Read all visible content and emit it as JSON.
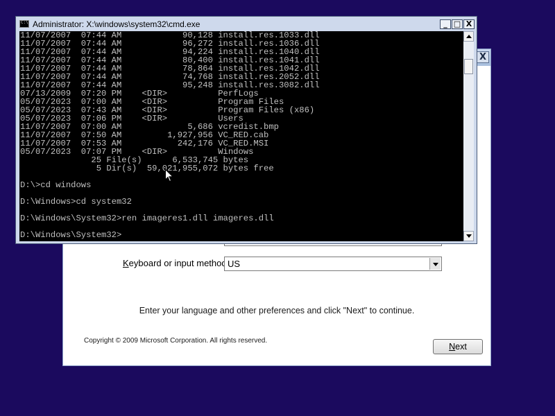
{
  "setup": {
    "keyboard_label_prefix": "",
    "keyboard_label_key": "K",
    "keyboard_label_rest": "eyboard or input method:",
    "keyboard_value": "US",
    "instructions": "Enter your language and other preferences and click \"Next\" to continue.",
    "copyright": "Copyright © 2009 Microsoft Corporation. All rights reserved.",
    "next_key": "N",
    "next_rest": "ext",
    "close_glyph": "X"
  },
  "cmd": {
    "title": "Administrator: X:\\windows\\system32\\cmd.exe",
    "minimize_glyph": "_",
    "maximize_glyph": "□",
    "close_glyph": "X",
    "lines": [
      "11/07/2007  07:44 AM            90,128 install.res.1033.dll",
      "11/07/2007  07:44 AM            96,272 install.res.1036.dll",
      "11/07/2007  07:44 AM            94,224 install.res.1040.dll",
      "11/07/2007  07:44 AM            80,400 install.res.1041.dll",
      "11/07/2007  07:44 AM            78,864 install.res.1042.dll",
      "11/07/2007  07:44 AM            74,768 install.res.2052.dll",
      "11/07/2007  07:44 AM            95,248 install.res.3082.dll",
      "07/13/2009  07:20 PM    <DIR>          PerfLogs",
      "05/07/2023  07:00 AM    <DIR>          Program Files",
      "05/07/2023  07:43 AM    <DIR>          Program Files (x86)",
      "05/07/2023  07:06 PM    <DIR>          Users",
      "11/07/2007  07:00 AM             5,686 vcredist.bmp",
      "11/07/2007  07:50 AM         1,927,956 VC_RED.cab",
      "11/07/2007  07:53 AM           242,176 VC_RED.MSI",
      "05/07/2023  07:07 PM    <DIR>          Windows",
      "              25 File(s)      6,533,745 bytes",
      "               5 Dir(s)  59,021,955,072 bytes free",
      "",
      "D:\\>cd windows",
      "",
      "D:\\Windows>cd system32",
      "",
      "D:\\Windows\\System32>ren imageres1.dll imageres.dll",
      "",
      "D:\\Windows\\System32>"
    ]
  },
  "colors": {
    "desktop": "#1b0a5e",
    "console_bg": "#000000",
    "console_text": "#c0c0c0"
  },
  "icons": [
    "console-app-icon",
    "mouse-pointer-icon",
    "chevron-down-icon"
  ]
}
